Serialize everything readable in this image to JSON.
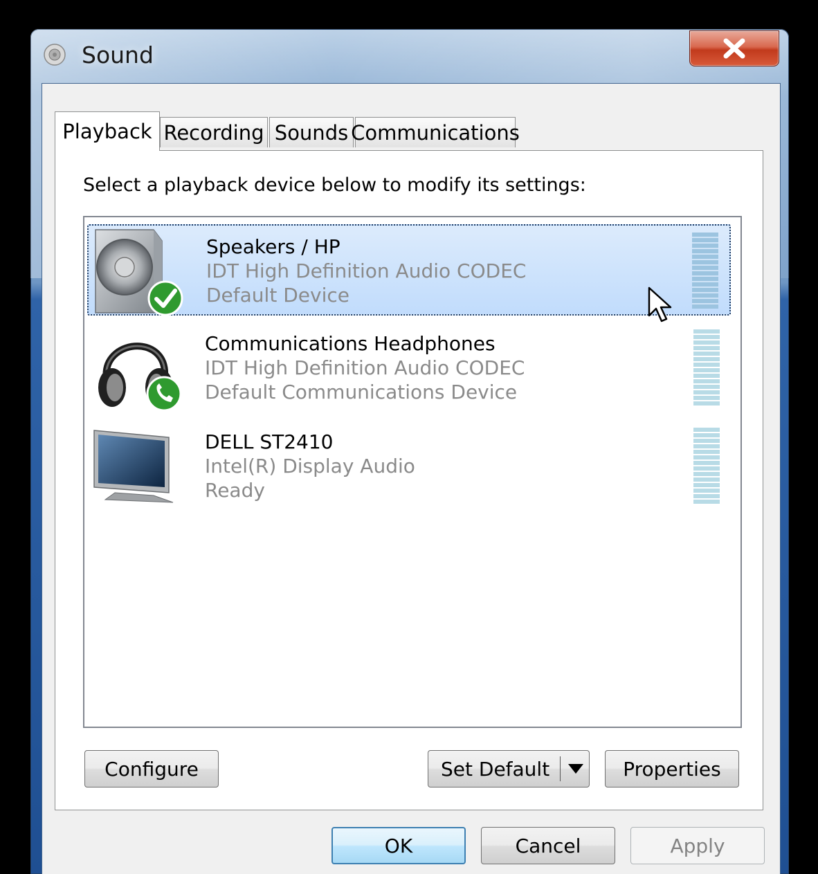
{
  "window": {
    "title": "Sound",
    "app_icon": "sound-icon",
    "close_icon": "close-icon"
  },
  "tabs": [
    {
      "label": "Playback",
      "active": true
    },
    {
      "label": "Recording",
      "active": false
    },
    {
      "label": "Sounds",
      "active": false
    },
    {
      "label": "Communications",
      "active": false
    }
  ],
  "playback": {
    "instruction": "Select a playback device below to modify its settings:",
    "devices": [
      {
        "name": "Speakers / HP",
        "driver": "IDT High Definition Audio CODEC",
        "status": "Default Device",
        "icon": "speaker-icon",
        "badge": "default-check-icon",
        "selected": true
      },
      {
        "name": "Communications Headphones",
        "driver": "IDT High Definition Audio CODEC",
        "status": "Default Communications Device",
        "icon": "headphones-icon",
        "badge": "phone-badge-icon",
        "selected": false
      },
      {
        "name": "DELL ST2410",
        "driver": "Intel(R) Display Audio",
        "status": "Ready",
        "icon": "monitor-icon",
        "selected": false
      }
    ],
    "buttons": {
      "configure": "Configure",
      "set_default": "Set Default",
      "properties": "Properties"
    }
  },
  "dialog_buttons": {
    "ok": "OK",
    "cancel": "Cancel",
    "apply": "Apply"
  },
  "colors": {
    "selection": "#c1dcfc",
    "title_bar": "#6f97c4",
    "close_button": "#c23a1c"
  }
}
